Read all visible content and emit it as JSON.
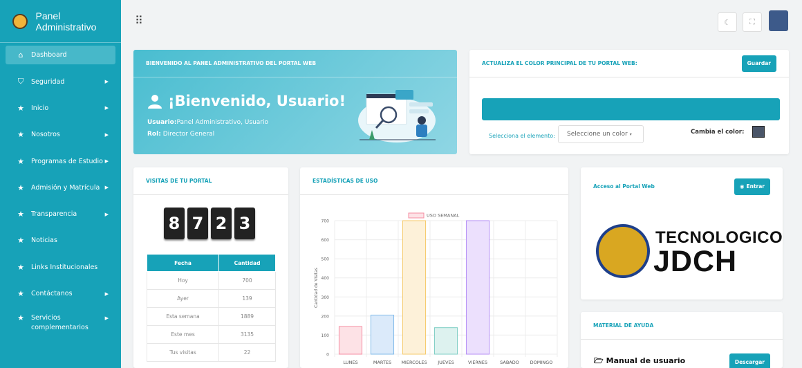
{
  "sidebar": {
    "brand": "Panel Administrativo",
    "items": [
      {
        "label": "Dashboard",
        "icon": "home-icon",
        "arrow": false
      },
      {
        "label": "Seguridad",
        "icon": "shield-icon",
        "arrow": true
      },
      {
        "label": "Inicio",
        "icon": "star-icon",
        "arrow": true
      },
      {
        "label": "Nosotros",
        "icon": "star-icon",
        "arrow": true
      },
      {
        "label": "Programas de Estudio",
        "icon": "star-icon",
        "arrow": true
      },
      {
        "label": "Admisión y Matrícula",
        "icon": "star-icon",
        "arrow": true
      },
      {
        "label": "Transparencia",
        "icon": "star-icon",
        "arrow": true
      },
      {
        "label": "Noticias",
        "icon": "star-icon",
        "arrow": false
      },
      {
        "label": "Links Institucionales",
        "icon": "star-icon",
        "arrow": false
      },
      {
        "label": "Contáctanos",
        "icon": "star-icon",
        "arrow": true
      },
      {
        "label": "Servicios complementarios",
        "icon": "star-icon",
        "arrow": true
      }
    ]
  },
  "welcome": {
    "header": "BIENVENIDO AL PANEL ADMINISTRATIVO DEL PORTAL WEB",
    "title": "¡Bienvenido, Usuario!",
    "user_label": "Usuario:",
    "user_value": "Panel Administrativo, Usuario",
    "role_label": "Rol:",
    "role_value": "Director General"
  },
  "color_panel": {
    "header": "ACTUALIZA EL COLOR PRINCIPAL DE TU PORTAL WEB:",
    "save_label": "Guardar",
    "select_label": "Selecciona el elemento:",
    "select_value": "Seleccione un color",
    "change_label": "Cambia el color:",
    "bar_color": "#17a2b8",
    "swatch_color": "#4a5568"
  },
  "visits": {
    "header": "VISITAS DE TU PORTAL",
    "digits": [
      "8",
      "7",
      "2",
      "3"
    ],
    "columns": [
      "Fecha",
      "Cantidad"
    ],
    "rows": [
      [
        "Hoy",
        "700"
      ],
      [
        "Ayer",
        "139"
      ],
      [
        "Esta semana",
        "1889"
      ],
      [
        "Este mes",
        "3135"
      ],
      [
        "Tus visitas",
        "22"
      ]
    ]
  },
  "stats": {
    "header": "ESTADÍSTICAS DE USO"
  },
  "chart_data": {
    "type": "bar",
    "categories": [
      "LUNES",
      "MARTES",
      "MIERCOLES",
      "JUEVES",
      "VIERNES",
      "SABADO",
      "DOMINGO"
    ],
    "series": [
      {
        "name": "USO SEMANAL",
        "values": [
          145,
          205,
          700,
          139,
          700,
          0,
          0
        ]
      }
    ],
    "ylabel": "Cantidad de Visitas",
    "ylim": [
      0,
      700
    ],
    "yticks": [
      0,
      100,
      200,
      300,
      400,
      500,
      600,
      700
    ],
    "fills": [
      "#fde2e6",
      "#dbeafa",
      "#fdf1d9",
      "#ddf2ef",
      "#ece0fd",
      "#eeeeee",
      "#eeeeee"
    ],
    "strokes": [
      "#f58ca2",
      "#7fb9ea",
      "#f6c96a",
      "#7ecec4",
      "#b58ef5",
      "#cccccc",
      "#cccccc"
    ],
    "legend": "top",
    "grid": true
  },
  "access": {
    "header": "Acceso al Portal Web",
    "enter_label": "Entrar",
    "name_line1": "TECNOLOGICO",
    "name_line2": "JDCH"
  },
  "help": {
    "header": "MATERIAL DE AYUDA",
    "item": "Manual de usuario",
    "download_label": "Descargar"
  }
}
